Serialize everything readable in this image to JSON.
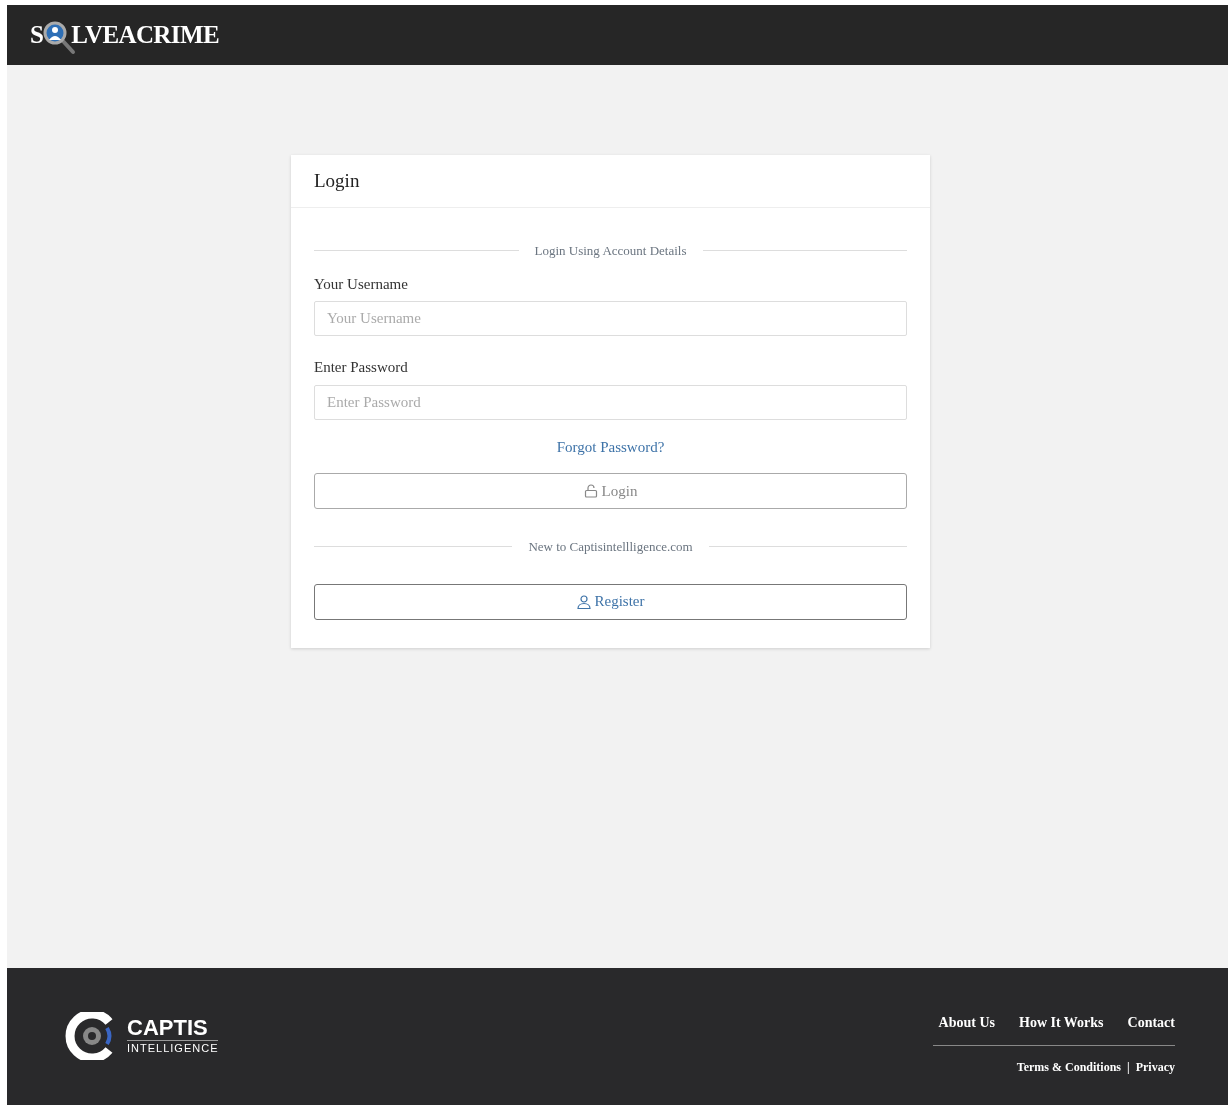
{
  "header": {
    "logo": {
      "before": "S",
      "after": "LVEACRIME"
    }
  },
  "card": {
    "title": "Login",
    "section_label": "Login Using Account Details",
    "fields": [
      {
        "label": "Your Username",
        "placeholder": "Your Username"
      },
      {
        "label": "Enter Password",
        "placeholder": "Enter Password"
      }
    ],
    "forgot_link": "Forgot Password?",
    "login_button": "Login",
    "register_label": "New to Captisintellligence.com",
    "register_button": "Register"
  },
  "footer": {
    "logo": {
      "name": "CAPTIS",
      "tagline": "INTELLIGENCE"
    },
    "links": [
      "About Us",
      "How It Works",
      "Contact"
    ],
    "legal_links": [
      "Terms & Conditions",
      "Privacy"
    ],
    "separator": "|"
  }
}
